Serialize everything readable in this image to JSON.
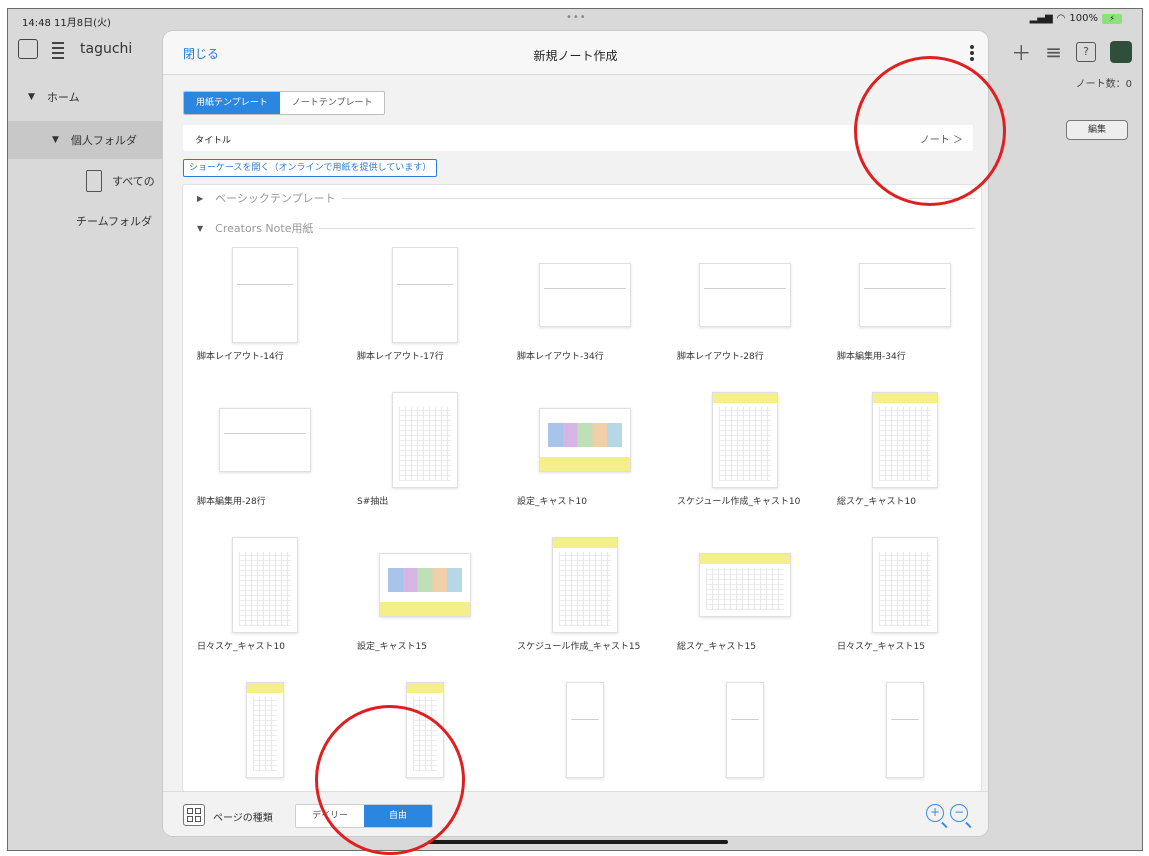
{
  "status_bar": {
    "time": "14:48  11月8日(火)",
    "center_dots": "•••",
    "battery": "100%"
  },
  "sidebar": {
    "user": "taguchi",
    "items": [
      {
        "label": "ホーム"
      },
      {
        "label": "個人フォルダ"
      },
      {
        "label": "すべての"
      },
      {
        "label": "チームフォルダ"
      }
    ]
  },
  "background": {
    "note_count": "ノート数：0",
    "edit_label": "編集"
  },
  "sheet": {
    "close_label": "閉じる",
    "title": "新規ノート作成",
    "tabs": [
      {
        "label": "用紙テンプレート",
        "active": true
      },
      {
        "label": "ノートテンプレート",
        "active": false
      }
    ],
    "title_field": {
      "label": "タイトル",
      "value": "ノート ＞"
    },
    "showcase_link": "ショーケースを開く（オンラインで用紙を提供しています）",
    "sections": [
      {
        "label": "ベーシックテンプレート",
        "expanded": false
      },
      {
        "label": "Creators Note用紙",
        "expanded": true
      }
    ],
    "templates": [
      {
        "name": "脚本レイアウト-14行",
        "shape": "portrait",
        "style": "blank"
      },
      {
        "name": "脚本レイアウト-17行",
        "shape": "portrait",
        "style": "blank"
      },
      {
        "name": "脚本レイアウト-34行",
        "shape": "landscape",
        "style": "blank"
      },
      {
        "name": "脚本レイアウト-28行",
        "shape": "landscape",
        "style": "blank"
      },
      {
        "name": "脚本編集用-34行",
        "shape": "landscape",
        "style": "blank"
      },
      {
        "name": "脚本編集用-28行",
        "shape": "landscape",
        "style": "blank"
      },
      {
        "name": "S#抽出",
        "shape": "portrait",
        "style": "grid"
      },
      {
        "name": "設定_キャスト10",
        "shape": "landscape",
        "style": "color"
      },
      {
        "name": "スケジュール作成_キャスト10",
        "shape": "portrait",
        "style": "yellow"
      },
      {
        "name": "総スケ_キャスト10",
        "shape": "portrait",
        "style": "yellow"
      },
      {
        "name": "日々スケ_キャスト10",
        "shape": "portrait",
        "style": "grid"
      },
      {
        "name": "設定_キャスト15",
        "shape": "landscape",
        "style": "color"
      },
      {
        "name": "スケジュール作成_キャスト15",
        "shape": "portrait",
        "style": "yellow"
      },
      {
        "name": "総スケ_キャスト15",
        "shape": "landscape",
        "style": "yellow"
      },
      {
        "name": "日々スケ_キャスト15",
        "shape": "portrait",
        "style": "grid"
      },
      {
        "name": "",
        "shape": "narrow",
        "style": "yellow"
      },
      {
        "name": "",
        "shape": "narrow",
        "style": "yellow"
      },
      {
        "name": "",
        "shape": "narrow",
        "style": "blank"
      },
      {
        "name": "",
        "shape": "narrow",
        "style": "blank"
      },
      {
        "name": "",
        "shape": "narrow",
        "style": "blank"
      }
    ],
    "bottom": {
      "page_kind_label": "ページの種類",
      "options": [
        {
          "label": "デイリー",
          "active": false
        },
        {
          "label": "自由",
          "active": true
        }
      ]
    }
  },
  "colors": {
    "accent": "#2b86e0",
    "annotation": "#e02020"
  }
}
